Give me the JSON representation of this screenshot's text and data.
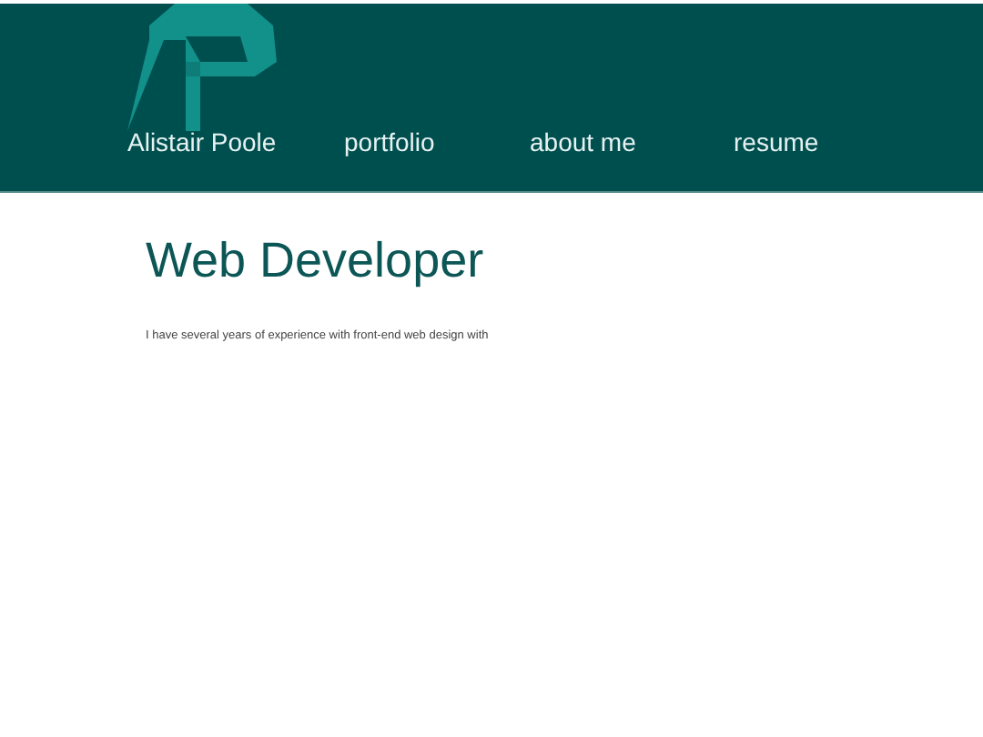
{
  "header": {
    "nav": [
      {
        "label": "Alistair Poole"
      },
      {
        "label": "portfolio"
      },
      {
        "label": "about me"
      },
      {
        "label": "resume"
      }
    ]
  },
  "main": {
    "title": "Web Developer",
    "paragraph": "I have several years of experience with front-end web design with"
  }
}
